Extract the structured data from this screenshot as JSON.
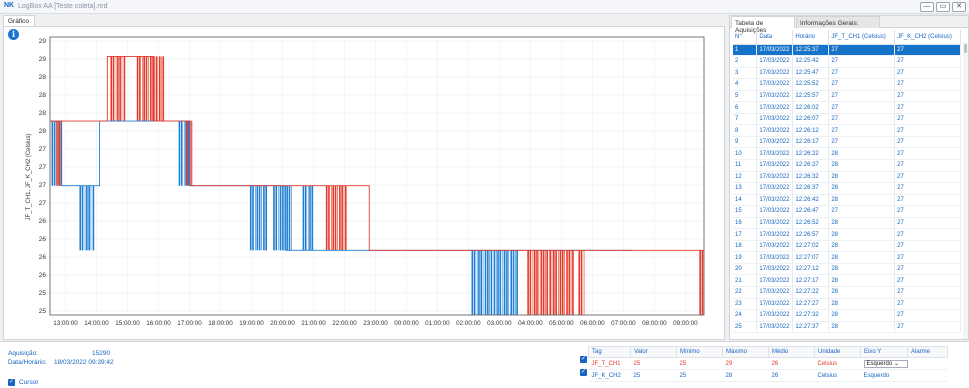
{
  "window": {
    "logo": "NK",
    "title": "LogBox AA [Teste coleta].nrd",
    "btn_min": "—",
    "btn_max": "▭",
    "btn_close": "✕"
  },
  "tabs": {
    "chart": "Gráfico",
    "table": "Tabela de Aquisições",
    "info": "Informações Gerais:"
  },
  "chart_data": {
    "type": "line",
    "ylabel": "JF_T_CH1, JF_K_CH2 (Celsius)",
    "y_ticks": [
      "29",
      "29",
      "28",
      "28",
      "28",
      "28",
      "27",
      "27",
      "27",
      "27",
      "26",
      "26",
      "26",
      "26",
      "25",
      "25"
    ],
    "x_ticks": [
      "13:00:00",
      "14:00:00",
      "15:00:00",
      "16:00:00",
      "17:00:00",
      "18:00:00",
      "19:00:00",
      "20:00:00",
      "21:00:00",
      "22:00:00",
      "23:00:00",
      "00:00:00",
      "01:00:00",
      "02:00:00",
      "03:00:00",
      "04:00:00",
      "05:00:00",
      "06:00:00",
      "07:00:00",
      "08:00:00",
      "09:00:00"
    ],
    "x_range_hours": [
      12.5,
      33.6
    ],
    "y_range": [
      25,
      29.3
    ],
    "grid": true,
    "series": [
      {
        "color": "#1f7fd4",
        "points": [
          [
            12.5,
            28
          ],
          [
            12.85,
            27
          ],
          [
            14.1,
            28
          ],
          [
            17.0,
            27
          ],
          [
            20.1,
            26
          ],
          [
            31.3,
            26
          ]
        ]
      },
      {
        "color": "#e53a2a",
        "points": [
          [
            12.5,
            28
          ],
          [
            14.1,
            28
          ],
          [
            14.35,
            29
          ],
          [
            15.75,
            29
          ],
          [
            15.85,
            28
          ],
          [
            17.0,
            28
          ],
          [
            17.05,
            27
          ],
          [
            20.1,
            27
          ],
          [
            22.8,
            26
          ],
          [
            33.6,
            26
          ]
        ]
      }
    ],
    "bursts": [
      {
        "color": "#1f7fd4",
        "from": 12.55,
        "to": 12.9,
        "y1": 28,
        "y2": 27
      },
      {
        "color": "#e53a2a",
        "from": 12.7,
        "to": 12.9,
        "y1": 28,
        "y2": 27
      },
      {
        "color": "#1f7fd4",
        "from": 13.45,
        "to": 13.9,
        "y1": 27,
        "y2": 26
      },
      {
        "color": "#e53a2a",
        "from": 14.45,
        "to": 14.9,
        "y1": 29,
        "y2": 28
      },
      {
        "color": "#e53a2a",
        "from": 15.3,
        "to": 16.15,
        "y1": 29,
        "y2": 28
      },
      {
        "color": "#1f7fd4",
        "from": 16.65,
        "to": 16.95,
        "y1": 28,
        "y2": 27
      },
      {
        "color": "#e53a2a",
        "from": 16.9,
        "to": 17.1,
        "y1": 28,
        "y2": 27
      },
      {
        "color": "#1f7fd4",
        "from": 18.95,
        "to": 19.5,
        "y1": 27,
        "y2": 26
      },
      {
        "color": "#1f7fd4",
        "from": 19.7,
        "to": 20.3,
        "y1": 27,
        "y2": 26
      },
      {
        "color": "#1f7fd4",
        "from": 20.65,
        "to": 21.0,
        "y1": 27,
        "y2": 26
      },
      {
        "color": "#e53a2a",
        "from": 21.4,
        "to": 22.05,
        "y1": 27,
        "y2": 26
      },
      {
        "color": "#1f7fd4",
        "from": 26.1,
        "to": 27.6,
        "y1": 26,
        "y2": 25
      },
      {
        "color": "#e53a2a",
        "from": 27.9,
        "to": 29.35,
        "y1": 26,
        "y2": 25
      },
      {
        "color": "#e53a2a",
        "from": 29.55,
        "to": 29.75,
        "y1": 26,
        "y2": 25
      },
      {
        "color": "#e53a2a",
        "from": 33.45,
        "to": 33.6,
        "y1": 26,
        "y2": 25
      }
    ]
  },
  "table": {
    "headers": [
      "N°",
      "Data",
      "Horário",
      "JF_T_CH1 (Celsius)",
      "JF_K_CH2 (Celsius)"
    ],
    "rows": [
      [
        "1",
        "17/03/2022",
        "12:25:37",
        "27",
        "27"
      ],
      [
        "2",
        "17/03/2022",
        "12:25:42",
        "27",
        "27"
      ],
      [
        "3",
        "17/03/2022",
        "12:25:47",
        "27",
        "27"
      ],
      [
        "4",
        "17/03/2022",
        "12:25:52",
        "27",
        "27"
      ],
      [
        "5",
        "17/03/2022",
        "12:25:57",
        "27",
        "27"
      ],
      [
        "6",
        "17/03/2022",
        "12:26:02",
        "27",
        "27"
      ],
      [
        "7",
        "17/03/2022",
        "12:26:07",
        "27",
        "27"
      ],
      [
        "8",
        "17/03/2022",
        "12:26:12",
        "27",
        "27"
      ],
      [
        "9",
        "17/03/2022",
        "12:26:17",
        "27",
        "27"
      ],
      [
        "10",
        "17/03/2022",
        "12:26:22",
        "28",
        "27"
      ],
      [
        "11",
        "17/03/2022",
        "12:26:27",
        "28",
        "27"
      ],
      [
        "12",
        "17/03/2022",
        "12:26:32",
        "28",
        "27"
      ],
      [
        "13",
        "17/03/2022",
        "12:26:37",
        "28",
        "27"
      ],
      [
        "14",
        "17/03/2022",
        "12:26:42",
        "28",
        "27"
      ],
      [
        "15",
        "17/03/2022",
        "12:26:47",
        "27",
        "27"
      ],
      [
        "16",
        "17/03/2022",
        "12:26:52",
        "28",
        "27"
      ],
      [
        "17",
        "17/03/2022",
        "12:26:57",
        "28",
        "27"
      ],
      [
        "18",
        "17/03/2022",
        "12:27:02",
        "28",
        "27"
      ],
      [
        "19",
        "17/03/2022",
        "12:27:07",
        "28",
        "27"
      ],
      [
        "20",
        "17/03/2022",
        "12:27:12",
        "28",
        "27"
      ],
      [
        "21",
        "17/03/2022",
        "12:27:17",
        "28",
        "27"
      ],
      [
        "22",
        "17/03/2022",
        "12:27:22",
        "28",
        "27"
      ],
      [
        "23",
        "17/03/2022",
        "12:27:27",
        "28",
        "27"
      ],
      [
        "24",
        "17/03/2022",
        "12:27:32",
        "28",
        "27"
      ],
      [
        "25",
        "17/03/2022",
        "12:27:37",
        "28",
        "27"
      ]
    ]
  },
  "summary": {
    "acq_label": "Aquisição:",
    "acq_value": "15290",
    "dt_label": "Data/Horário:",
    "dt_value": "18/03/2022 09:39:42",
    "cursor_label": "Cursor"
  },
  "stats": {
    "headers": [
      "Tag",
      "Valor",
      "Mínimo",
      "Máximo",
      "Médio",
      "Unidade",
      "Eixo Y",
      "Alarme"
    ],
    "rows": [
      {
        "tag": "JF_T_CH1",
        "valor": "25",
        "minimo": "25",
        "maximo": "29",
        "medio": "26",
        "unidade": "Celsius",
        "eixo": "Esquerdo",
        "alarme": "",
        "color": "#e53a2a"
      },
      {
        "tag": "JF_K_CH2",
        "valor": "25",
        "minimo": "25",
        "maximo": "28",
        "medio": "26",
        "unidade": "Celsius",
        "eixo": "Esquerdo",
        "alarme": "",
        "color": "#1565c0"
      }
    ]
  }
}
